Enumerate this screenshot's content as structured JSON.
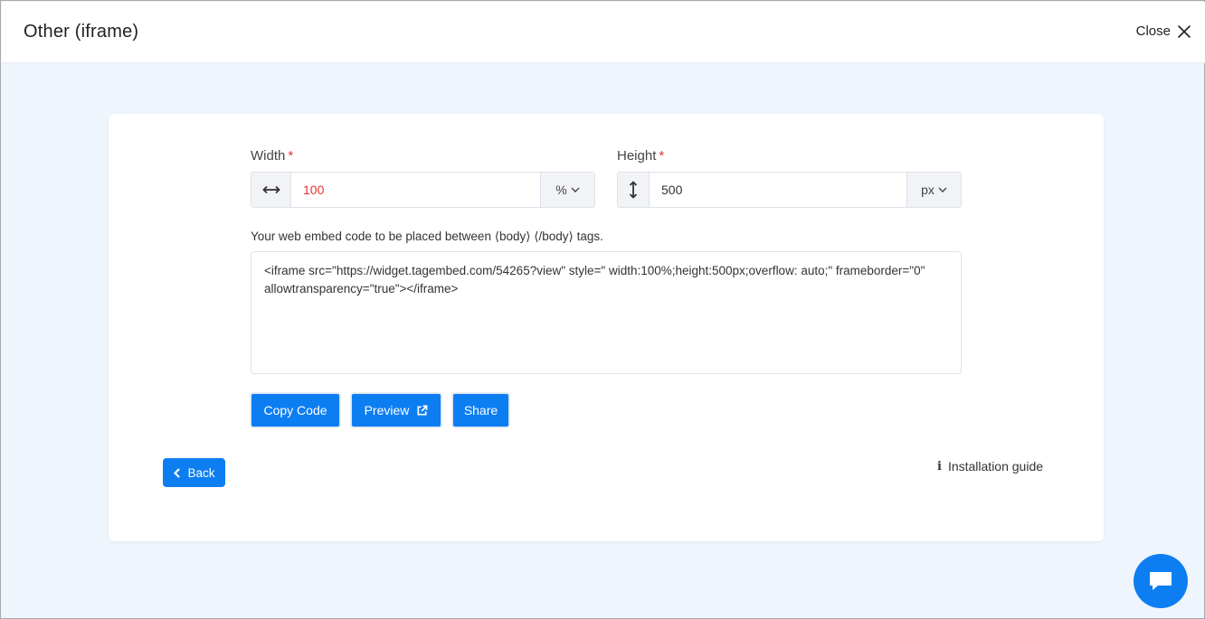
{
  "header": {
    "title": "Other (iframe)",
    "close_label": "Close"
  },
  "form": {
    "width": {
      "label": "Width",
      "required_mark": "*",
      "value": "100",
      "unit": "%"
    },
    "height": {
      "label": "Height",
      "required_mark": "*",
      "value": "500",
      "unit": "px"
    },
    "embed_label": "Your web embed code to be placed between ⟨body⟩ ⟨/body⟩ tags.",
    "embed_code": "<iframe src=\"https://widget.tagembed.com/54265?view\" style=\" width:100%;height:500px;overflow: auto;\" frameborder=\"0\" allowtransparency=\"true\"></iframe>"
  },
  "actions": {
    "copy_label": "Copy Code",
    "preview_label": "Preview",
    "share_label": "Share",
    "back_label": "Back",
    "guide_label": "Installation guide"
  },
  "colors": {
    "primary": "#0d7ef2",
    "required": "#e3342f",
    "background": "#eef5fd"
  }
}
